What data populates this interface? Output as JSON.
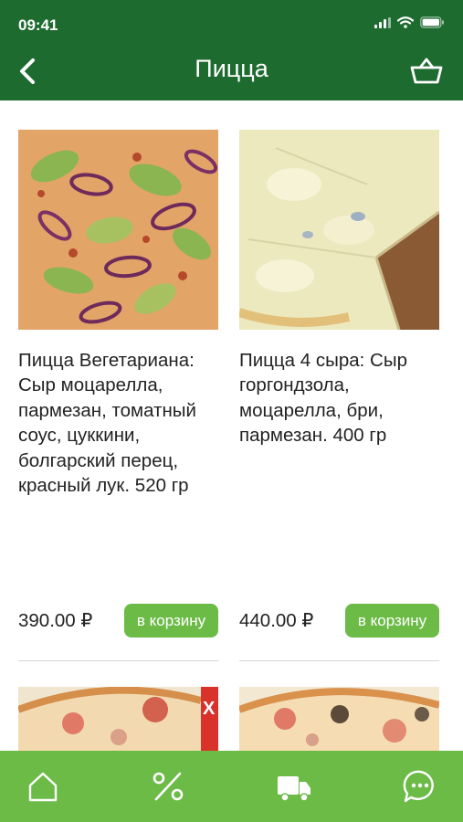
{
  "status_bar": {
    "time": "09:41"
  },
  "header": {
    "title": "Пицца"
  },
  "products": [
    {
      "description": "Пицца Вегетариана: Сыр моцарелла, пармезан, томатный соус, цуккини, болгарский перец, красный лук. 520 гр",
      "price": "390.00 ₽",
      "button_label": "в корзину"
    },
    {
      "description": "Пицца 4 сыра: Сыр горгондзола, моцарелла, бри, пармезан. 400 гр",
      "price": "440.00 ₽",
      "button_label": "в корзину"
    }
  ],
  "tab_bar": {
    "items": [
      "home-icon",
      "percent-icon",
      "delivery-truck-icon",
      "chat-icon"
    ]
  },
  "colors": {
    "header_bg": "#1e6b30",
    "accent": "#6cbb47"
  }
}
